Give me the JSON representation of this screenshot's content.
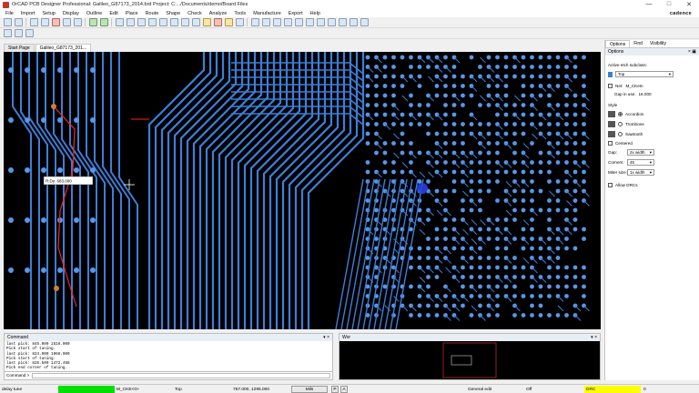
{
  "title_bar": {
    "title": "OrCAD PCB Designer Professional: Galileo_G87173_2014.brd  Project: C:.../Documents/demo/Board Files",
    "minimize": "—",
    "maximize": "□",
    "close": "✕"
  },
  "menu": {
    "items": [
      "File",
      "Import",
      "Setup",
      "Display",
      "Outline",
      "Edit",
      "Place",
      "Route",
      "Shape",
      "Check",
      "Analyze",
      "Tools",
      "Manufacture",
      "Export",
      "Help"
    ],
    "brand": "cadence"
  },
  "tabs": [
    "Start Page",
    "Galileo_G87173_201..."
  ],
  "canvas": {
    "coordinate_tooltip": "R:Dy:  683.000",
    "colors": {
      "background": "#000000",
      "trace": "#3c7fd8",
      "pad": "#5a96e6",
      "highlight": "#ff2020"
    }
  },
  "options_panel": {
    "tabs": [
      "Options",
      "Find",
      "Visibility"
    ],
    "header": "Options",
    "active_subclass_label": "Active etch subclass:",
    "subclass_value": "Top",
    "net_label": "Net:",
    "net_value": "M_CKeIn",
    "gap_in_use_label": "Gap in use:",
    "gap_in_use_value": "16.000",
    "style_label": "Style",
    "styles": [
      "Accordion",
      "Trombone",
      "Sawtooth"
    ],
    "selected_style": "Accordion",
    "centered_label": "Centered",
    "gap_label": "Gap:",
    "gap_value": "2x width",
    "corners_label": "Corners:",
    "corners_value": "45",
    "miter_label": "Miter size:",
    "miter_value": "1x width",
    "allow_drcs_label": "Allow DRCs"
  },
  "command_panel": {
    "title": "Command",
    "lines": [
      "last pick:  845.000 1516.000",
      "Pick start of tuning.",
      "last pick:  824.000 1968.000",
      "Pick start of tuning.",
      "last pick:  826.500 1472.468",
      "Pick end corner of tuning."
    ],
    "prompt": "Command >"
  },
  "worldview_panel": {
    "title": "Wor"
  },
  "status_bar": {
    "mode": "delay tune",
    "net": "M_CKE<0>",
    "layer": "Top",
    "coordinates": "757.000, 1295.000",
    "units": "Mils",
    "p_button": "P",
    "a_button": "A",
    "edit_mode": "General edit",
    "off_label": "Off",
    "drc_label": "DRC",
    "drc_count": "0"
  }
}
